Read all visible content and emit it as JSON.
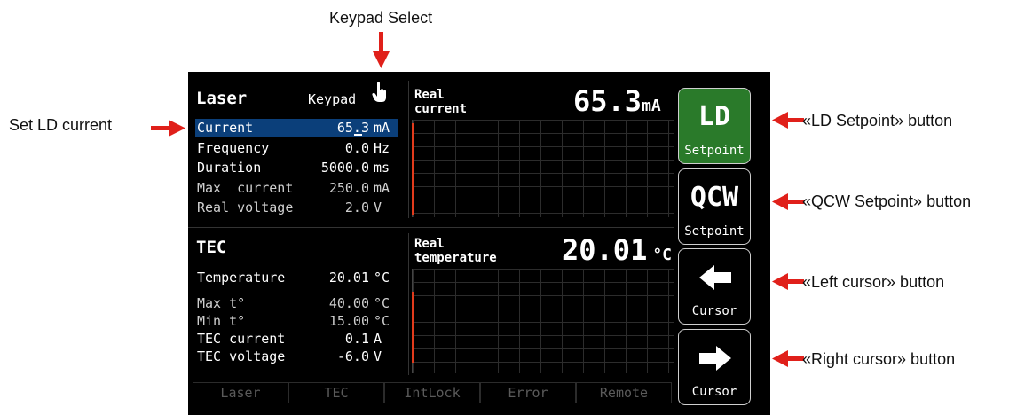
{
  "annotations": {
    "keypad_select": "Keypad Select",
    "set_ld_current": "Set LD current",
    "ld_setpoint_btn": "«LD Setpoint» button",
    "qcw_setpoint_btn": "«QCW Setpoint» button",
    "left_cursor_btn": "«Left cursor» button",
    "right_cursor_btn": "«Right cursor» button"
  },
  "laser": {
    "title": "Laser",
    "keypad": "Keypad",
    "rows": [
      {
        "label": "Current",
        "value": "65.3",
        "unit": "mA"
      },
      {
        "label": "Frequency",
        "value": "0.0",
        "unit": "Hz"
      },
      {
        "label": "Duration",
        "value": "5000.0",
        "unit": "ms"
      },
      {
        "label": "Max  current",
        "value": "250.0",
        "unit": "mA"
      },
      {
        "label": "Real voltage",
        "value": "2.0",
        "unit": "V"
      }
    ],
    "real_label_1": "Real",
    "real_label_2": "current",
    "big_value": "65.3",
    "big_unit": "mA"
  },
  "tec": {
    "title": "TEC",
    "rows": [
      {
        "label": "Temperature",
        "value": "20.01",
        "unit": "°C"
      },
      {
        "label": "Max t°",
        "value": "40.00",
        "unit": "°C"
      },
      {
        "label": "Min t°",
        "value": "15.00",
        "unit": "°C"
      },
      {
        "label": "TEC current",
        "value": "0.1",
        "unit": "A"
      },
      {
        "label": "TEC voltage",
        "value": "-6.0",
        "unit": "V"
      }
    ],
    "real_label_1": "Real",
    "real_label_2": "temperature",
    "big_value": "20.01",
    "big_unit": "°C"
  },
  "side_buttons": {
    "ld": {
      "main": "LD",
      "sub": "Setpoint"
    },
    "qcw": {
      "main": "QCW",
      "sub": "Setpoint"
    },
    "left": {
      "sub": "Cursor"
    },
    "right": {
      "sub": "Cursor"
    }
  },
  "status": [
    "Laser",
    "TEC",
    "IntLock",
    "Error",
    "Remote"
  ],
  "colors": {
    "selected_row": "#0b3f7a",
    "ld_button": "#2a7a2a",
    "bar": "#e23b1c",
    "arrow": "#e0201a"
  }
}
